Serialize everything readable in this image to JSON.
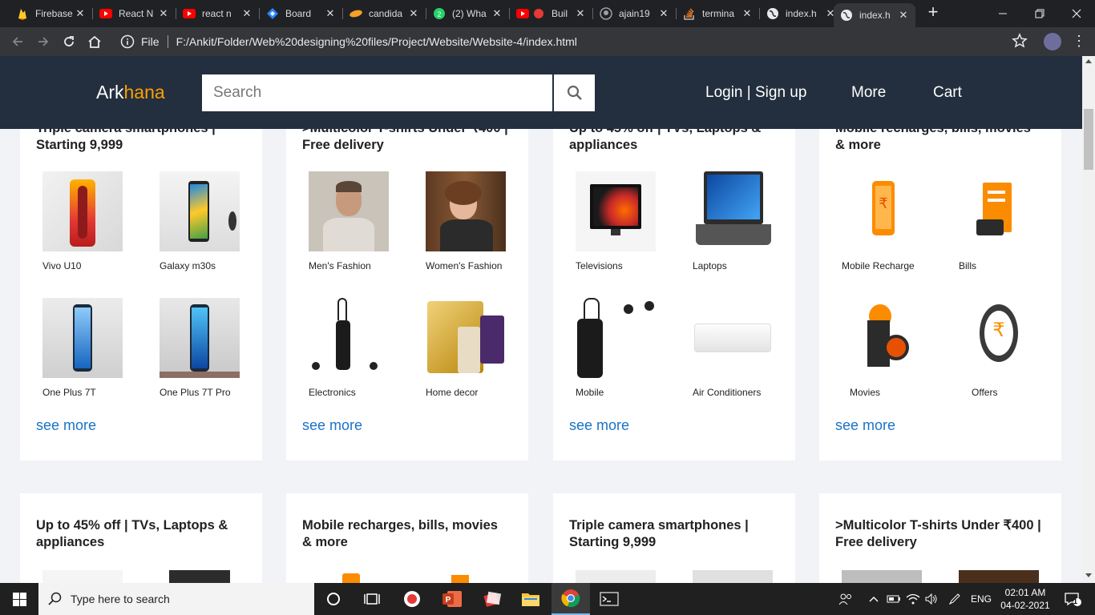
{
  "browser": {
    "tabs": [
      {
        "title": "Firebase",
        "icon": "firebase-icon"
      },
      {
        "title": "React N",
        "icon": "youtube-icon"
      },
      {
        "title": "react n",
        "icon": "youtube-icon"
      },
      {
        "title": "Board",
        "icon": "jira-icon"
      },
      {
        "title": "candida",
        "icon": "swiggy-icon"
      },
      {
        "title": "(2) Wha",
        "icon": "whatsapp-icon"
      },
      {
        "title": "Buil",
        "icon": "youtube-icon"
      },
      {
        "title": "ajain19",
        "icon": "github-icon"
      },
      {
        "title": "termina",
        "icon": "stackoverflow-icon"
      },
      {
        "title": "index.h",
        "icon": "globe-icon"
      },
      {
        "title": "index.h",
        "icon": "globe-icon"
      }
    ],
    "omnibox": {
      "scheme_label": "File",
      "url": "F:/Ankit/Folder/Web%20designing%20files/Project/Website/Website-4/index.html"
    }
  },
  "site": {
    "logo_part1": "Ark",
    "logo_part2": "hana",
    "search_placeholder": "Search",
    "nav": {
      "login": "Login | Sign up",
      "more": "More",
      "cart": "Cart"
    },
    "accent_color": "#ff9f00",
    "header_color": "#232f3e",
    "link_color": "#1a73c7"
  },
  "cards_row1": [
    {
      "title": "Triple camera smartphones | Starting 9,999",
      "products": [
        "Vivo U10",
        "Galaxy m30s",
        "One Plus 7T",
        "One Plus 7T Pro"
      ],
      "see_more": "see more"
    },
    {
      "title": ">Multicolor T-shirts Under ₹400 | Free delivery",
      "products": [
        "Men's Fashion",
        "Women's Fashion",
        "Electronics",
        "Home decor"
      ],
      "see_more": "see more"
    },
    {
      "title": "Up to 45% off | TVs, Laptops & appliances",
      "products": [
        "Televisions",
        "Laptops",
        "Mobile",
        "Air Conditioners"
      ],
      "see_more": "see more"
    },
    {
      "title": "Mobile recharges, bills, movies & more",
      "products": [
        "Mobile Recharge",
        "Bills",
        "Movies",
        "Offers"
      ],
      "see_more": "see more"
    }
  ],
  "cards_row2": [
    {
      "title": "Up to 45% off | TVs, Laptops & appliances"
    },
    {
      "title": "Mobile recharges, bills, movies & more"
    },
    {
      "title": "Triple camera smartphones | Starting 9,999"
    },
    {
      "title": ">Multicolor T-shirts Under ₹400 | Free delivery"
    }
  ],
  "taskbar": {
    "search_placeholder": "Type here to search",
    "language": "ENG",
    "time": "02:01 AM",
    "date": "04-02-2021",
    "notification_count": "1"
  }
}
